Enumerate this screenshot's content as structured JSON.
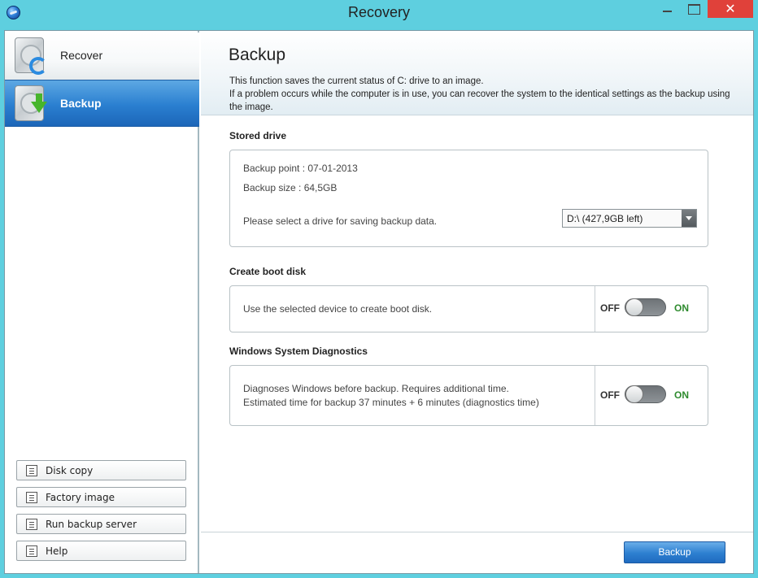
{
  "window": {
    "title": "Recovery",
    "close_glyph": "✕"
  },
  "sidebar": {
    "nav": [
      {
        "label": "Recover",
        "icon": "drive-recover-icon",
        "selected": false
      },
      {
        "label": "Backup",
        "icon": "drive-backup-icon",
        "selected": true
      }
    ],
    "buttons": [
      {
        "label": "Disk copy",
        "icon": "disk-copy-icon"
      },
      {
        "label": "Factory image",
        "icon": "factory-image-icon"
      },
      {
        "label": "Run backup server",
        "icon": "backup-server-icon"
      },
      {
        "label": "Help",
        "icon": "help-icon"
      }
    ]
  },
  "main": {
    "title": "Backup",
    "description": "This function saves the current status of C: drive to an image.\nIf a problem occurs while the computer is in use, you can recover the system to the identical settings as the backup using the image.",
    "stored_drive": {
      "title": "Stored drive",
      "backup_point": "Backup point : 07-01-2013",
      "backup_size": "Backup size : 64,5GB",
      "select_prompt": "Please select a drive for saving backup data.",
      "selected_drive": "D:\\ (427,9GB left)"
    },
    "boot_disk": {
      "title": "Create boot disk",
      "text": "Use the selected device to create boot disk.",
      "off_label": "OFF",
      "on_label": "ON",
      "state": "off"
    },
    "diagnostics": {
      "title": "Windows System Diagnostics",
      "text_line1": "Diagnoses Windows before backup. Requires additional time.",
      "text_line2": "Estimated time for backup 37 minutes + 6 minutes (diagnostics time)",
      "off_label": "OFF",
      "on_label": "ON",
      "state": "off"
    },
    "primary_button": "Backup"
  },
  "colors": {
    "titlebar": "#5ecfdf",
    "accent": "#2a7fd0",
    "close": "#e0413a",
    "on_label": "#2e8b2e"
  }
}
